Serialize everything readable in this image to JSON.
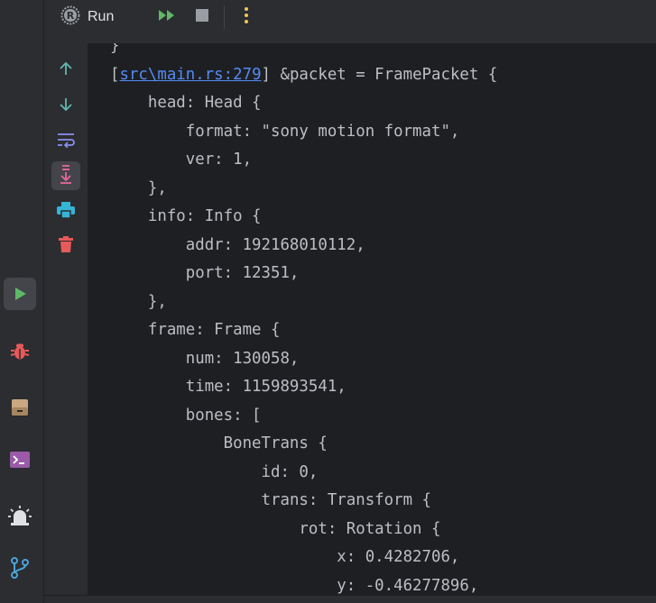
{
  "run_header": {
    "tab_label": "Run"
  },
  "icons": {
    "run_tab": "rust-logo-icon",
    "rerun": "rerun-double-play-icon",
    "stop": "stop-icon",
    "more": "more-vertical-icon",
    "tool_run": "run-play-icon",
    "tool_debug": "bug-icon",
    "tool_services": "services-icon",
    "tool_terminal": "terminal-icon",
    "tool_problems": "problems-alarm-icon",
    "tool_git": "git-branch-icon",
    "up": "arrow-up-icon",
    "down": "arrow-down-icon",
    "wrap": "soft-wrap-icon",
    "scroll_end": "scroll-to-end-icon",
    "print": "print-icon",
    "clear": "trash-icon"
  },
  "colors": {
    "accent_green": "#5fb865",
    "accent_yellow": "#f2c55c",
    "stop_gray": "#9a9da3",
    "debug_red": "#e75a5a",
    "link_blue": "#548af7",
    "toolbar_blue": "#4aa3d9",
    "scroll_pink": "#e8679b"
  },
  "console": {
    "lines": [
      {
        "indent": "",
        "text": "}"
      },
      {
        "indent": "",
        "prefix": "[",
        "link": "src\\main.rs:279",
        "text": "] &packet = FramePacket {"
      },
      {
        "indent": "    ",
        "text": "head: Head {"
      },
      {
        "indent": "        ",
        "text": "format: \"sony motion format\","
      },
      {
        "indent": "        ",
        "text": "ver: 1,"
      },
      {
        "indent": "    ",
        "text": "},"
      },
      {
        "indent": "    ",
        "text": "info: Info {"
      },
      {
        "indent": "        ",
        "text": "addr: 192168010112,"
      },
      {
        "indent": "        ",
        "text": "port: 12351,"
      },
      {
        "indent": "    ",
        "text": "},"
      },
      {
        "indent": "    ",
        "text": "frame: Frame {"
      },
      {
        "indent": "        ",
        "text": "num: 130058,"
      },
      {
        "indent": "        ",
        "text": "time: 1159893541,"
      },
      {
        "indent": "        ",
        "text": "bones: ["
      },
      {
        "indent": "            ",
        "text": "BoneTrans {"
      },
      {
        "indent": "                ",
        "text": "id: 0,"
      },
      {
        "indent": "                ",
        "text": "trans: Transform {"
      },
      {
        "indent": "                    ",
        "text": "rot: Rotation {"
      },
      {
        "indent": "                        ",
        "text": "x: 0.4282706,"
      },
      {
        "indent": "                        ",
        "text": "y: -0.46277896,"
      }
    ]
  }
}
